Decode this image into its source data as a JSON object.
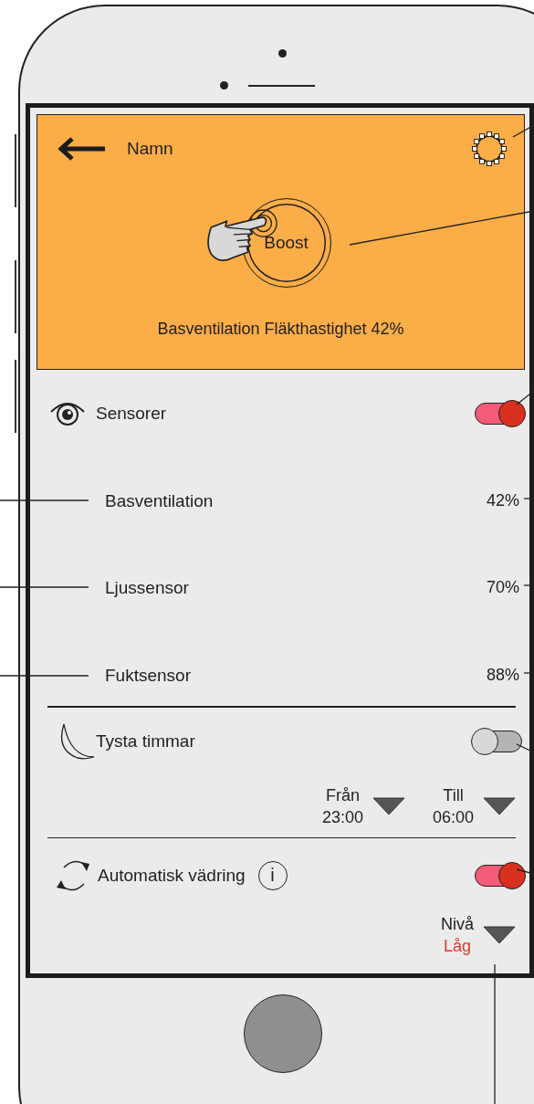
{
  "header": {
    "title": "Namn",
    "boost_button": "Boost",
    "status": "Basventilation Fläkthastighet 42%"
  },
  "sensors": {
    "label": "Sensorer",
    "on": true,
    "readings": [
      {
        "name": "Basventilation",
        "value": "42%"
      },
      {
        "name": "Ljussensor",
        "value": "70%"
      },
      {
        "name": "Fuktsensor",
        "value": "88%"
      }
    ]
  },
  "quiet_hours": {
    "label": "Tysta timmar",
    "on": false,
    "from": {
      "label": "Från",
      "value": "23:00"
    },
    "to": {
      "label": "Till",
      "value": "06:00"
    }
  },
  "auto_airing": {
    "label": "Automatisk vädring",
    "info_button": "i",
    "on": true,
    "intensity": {
      "label": "Nivå",
      "value": "Låg"
    }
  }
}
